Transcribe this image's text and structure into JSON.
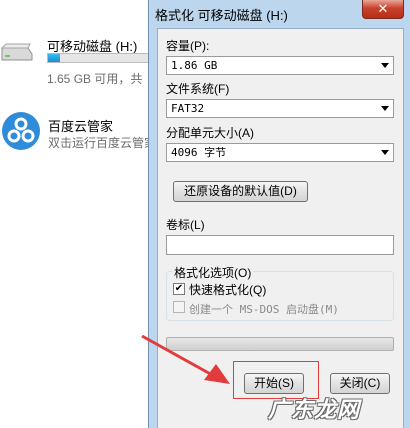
{
  "explorer": {
    "drive": {
      "name": "可移动磁盘 (H:)",
      "free_text": "1.65 GB 可用，共",
      "used_fraction": 0.12
    },
    "app": {
      "name": "百度云管家",
      "description": "双击运行百度云管家"
    }
  },
  "dialog": {
    "title": "格式化 可移动磁盘 (H:)",
    "close_glyph": "✕",
    "capacity": {
      "label": "容量(P):",
      "value": "1.86 GB"
    },
    "filesystem": {
      "label": "文件系统(F)",
      "value": "FAT32"
    },
    "allocation": {
      "label": "分配单元大小(A)",
      "value": "4096 字节"
    },
    "restore_defaults_label": "还原设备的默认值(D)",
    "volume_label": {
      "label": "卷标(L)",
      "value": ""
    },
    "format_options": {
      "title": "格式化选项(O)",
      "quick_format": {
        "label": "快速格式化(Q)",
        "checked": true
      },
      "msdos_boot": {
        "label": "创建一个 MS-DOS 启动盘(M)",
        "checked": false,
        "enabled": false
      }
    },
    "start_label": "开始(S)",
    "close_label": "关闭(C)"
  },
  "annotation": {
    "highlight_color": "#e23b3b",
    "arrow_color": "#e23b3b"
  },
  "watermark": {
    "text": "广东龙网"
  }
}
